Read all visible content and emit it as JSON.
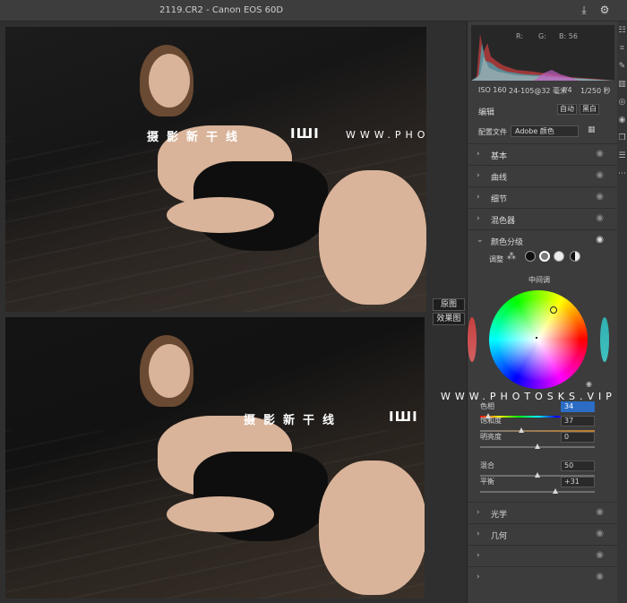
{
  "titlebar": {
    "title": "2119.CR2 - Canon EOS 60D"
  },
  "watermark": {
    "cn": "摄影新干线",
    "logo": "IШI",
    "url": "WWW.PHOTOSKS.VIP"
  },
  "compare": {
    "original_label": "原图",
    "effect_label": "效果图"
  },
  "histogram": {
    "r_label": "R:",
    "g_label": "G:",
    "b_label": "B: 56"
  },
  "camera_meta": {
    "iso": "ISO 160",
    "lens": "24-105@32 毫米",
    "aperture": "f/4",
    "shutter": "1/250 秒"
  },
  "edit": {
    "section_label": "编辑",
    "auto_label": "自动",
    "bw_label": "黑白",
    "profile_label": "配置文件",
    "profile_value": "Adobe 颜色"
  },
  "panels": [
    {
      "label": "基本",
      "state": "collapsed"
    },
    {
      "label": "曲线",
      "state": "collapsed"
    },
    {
      "label": "细节",
      "state": "collapsed"
    },
    {
      "label": "混色器",
      "state": "collapsed"
    },
    {
      "label": "颜色分级",
      "state": "expanded"
    }
  ],
  "color_grading": {
    "adjust_label": "调整",
    "wheel_label": "中间调",
    "hue_label": "色相",
    "hue_value": "34",
    "saturation_label": "饱和度",
    "saturation_value": "37",
    "luminance_label": "明亮度",
    "luminance_value": "0",
    "blend_label": "混合",
    "blend_value": "50",
    "balance_label": "平衡",
    "balance_value": "+31"
  },
  "bottom_panels": [
    {
      "label": "光学"
    },
    {
      "label": "几何"
    },
    {
      "label": ""
    },
    {
      "label": ""
    }
  ],
  "colors": {
    "panel_bg": "#3c3c3c",
    "viewer_bg": "#2f2f2f",
    "accent_blue": "#2b6cc4"
  }
}
